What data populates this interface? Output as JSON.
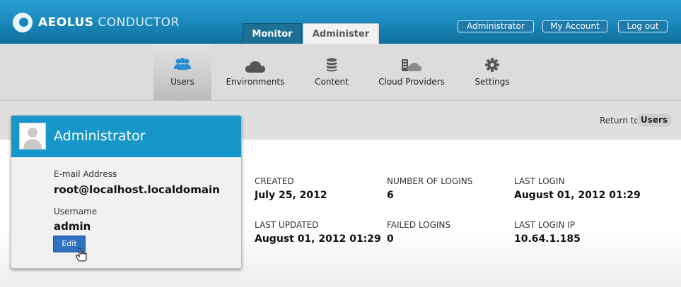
{
  "header": {
    "brand_bold": "AEOLUS",
    "brand_rest": "CONDUCTOR",
    "tabs": [
      "Monitor",
      "Administer"
    ],
    "user_links": [
      "Administrator",
      "My Account",
      "Log out"
    ]
  },
  "subnav": {
    "items": [
      {
        "label": "Users",
        "icon": "users-icon"
      },
      {
        "label": "Environments",
        "icon": "cloud-icon"
      },
      {
        "label": "Content",
        "icon": "database-icon"
      },
      {
        "label": "Cloud Providers",
        "icon": "building-cloud-icon"
      },
      {
        "label": "Settings",
        "icon": "gear-icon"
      }
    ]
  },
  "return": {
    "text": "Return to",
    "link": "Users"
  },
  "profile": {
    "name": "Administrator",
    "email_label": "E-mail Address",
    "email": "root@localhost.localdomain",
    "username_label": "Username",
    "username": "admin",
    "edit_label": "Edit"
  },
  "stats": {
    "created_label": "CREATED",
    "created": "July 25, 2012",
    "logins_label": "NUMBER OF LOGINS",
    "logins": "6",
    "last_login_label": "LAST LOGIN",
    "last_login": "August 01, 2012 01:29",
    "last_updated_label": "LAST UPDATED",
    "last_updated": "August 01, 2012 01:29",
    "failed_label": "FAILED LOGINS",
    "failed": "0",
    "last_ip_label": "LAST LOGIN IP",
    "last_ip": "10.64.1.185"
  },
  "colors": {
    "header_blue": "#1a87ba",
    "card_header": "#1797c9",
    "edit_button": "#2f72c2"
  }
}
